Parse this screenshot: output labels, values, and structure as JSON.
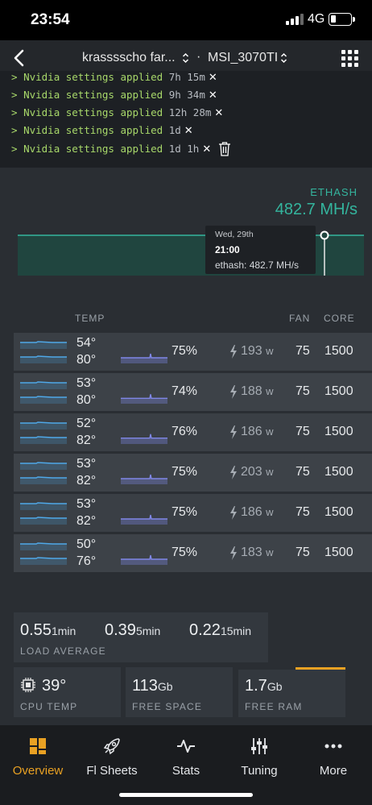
{
  "status_bar": {
    "time": "23:54",
    "network": "4G"
  },
  "header": {
    "rig_name": "krasssscho far...",
    "separator": "·",
    "gpu_name": "MSI_3070TI"
  },
  "log": [
    {
      "prompt": "> ",
      "message": "Nvidia settings applied",
      "age": "7h 15m"
    },
    {
      "prompt": "> ",
      "message": "Nvidia settings applied",
      "age": "9h 34m"
    },
    {
      "prompt": "> ",
      "message": "Nvidia settings applied",
      "age": "12h 28m"
    },
    {
      "prompt": "> ",
      "message": "Nvidia settings applied",
      "age": "1d"
    },
    {
      "prompt": "> ",
      "message": "Nvidia settings applied",
      "age": "1d 1h"
    }
  ],
  "log_close_glyph": "✕",
  "hashrate": {
    "algo": "ETHASH",
    "value": "482.7 MH/s"
  },
  "chart_data": {
    "type": "line",
    "series": [
      {
        "values": [
          482.7,
          482.7,
          482.7,
          482.7,
          482.7
        ]
      }
    ],
    "ylim": [
      0,
      482.7
    ]
  },
  "tooltip": {
    "date": "Wed, 29th",
    "time": "21:00",
    "value": "ethash: 482.7 MH/s"
  },
  "columns": {
    "temp": "TEMP",
    "fan": "FAN",
    "core": "CORE"
  },
  "gpus": [
    {
      "temp": "54°",
      "mem_temp": "80°",
      "util": "75%",
      "util_frac": 0.75,
      "power": "193",
      "power_unit": "w",
      "fan": "75",
      "core": "1500"
    },
    {
      "temp": "53°",
      "mem_temp": "80°",
      "util": "74%",
      "util_frac": 0.74,
      "power": "188",
      "power_unit": "w",
      "fan": "75",
      "core": "1500"
    },
    {
      "temp": "52°",
      "mem_temp": "82°",
      "util": "76%",
      "util_frac": 0.76,
      "power": "186",
      "power_unit": "w",
      "fan": "75",
      "core": "1500"
    },
    {
      "temp": "53°",
      "mem_temp": "82°",
      "util": "75%",
      "util_frac": 0.75,
      "power": "203",
      "power_unit": "w",
      "fan": "75",
      "core": "1500"
    },
    {
      "temp": "53°",
      "mem_temp": "82°",
      "util": "75%",
      "util_frac": 0.75,
      "power": "186",
      "power_unit": "w",
      "fan": "75",
      "core": "1500"
    },
    {
      "temp": "50°",
      "mem_temp": "76°",
      "util": "75%",
      "util_frac": 0.75,
      "power": "183",
      "power_unit": "w",
      "fan": "75",
      "core": "1500"
    }
  ],
  "load_average": {
    "label": "LOAD AVERAGE",
    "values": [
      {
        "value": "0.55",
        "period": "1min"
      },
      {
        "value": "0.39",
        "period": "5min"
      },
      {
        "value": "0.22",
        "period": "15min"
      }
    ]
  },
  "cpu_temp": {
    "value": "39°",
    "label": "CPU TEMP"
  },
  "free_space": {
    "value": "113",
    "unit": "Gb",
    "label": "FREE SPACE"
  },
  "free_ram": {
    "value": "1.7",
    "unit": "Gb",
    "label": "FREE RAM"
  },
  "tabs": [
    {
      "label": "Overview",
      "icon": "overview-icon",
      "active": true
    },
    {
      "label": "Fl Sheets",
      "icon": "rocket-icon",
      "active": false
    },
    {
      "label": "Stats",
      "icon": "pulse-icon",
      "active": false
    },
    {
      "label": "Tuning",
      "icon": "sliders-icon",
      "active": false
    },
    {
      "label": "More",
      "icon": "more-icon",
      "active": false
    }
  ],
  "colors": {
    "accent": "#e9a123",
    "hash": "#34b59e",
    "util": "#7f86e6",
    "temp": "#4fa8e8",
    "log": "#a8d86a"
  }
}
